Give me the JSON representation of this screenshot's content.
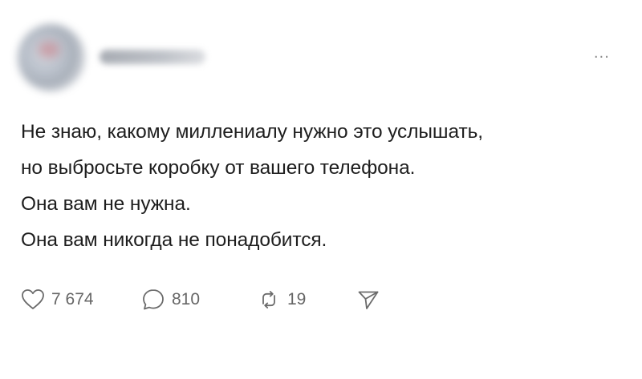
{
  "post": {
    "author_name": "",
    "more_label": "...",
    "lines": [
      "Не знаю, какому миллениалу нужно это услышать,",
      "но выбросьте коробку от вашего телефона.",
      "Она вам не нужна.",
      "Она вам никогда не понадобится."
    ],
    "actions": {
      "likes": "7 674",
      "comments": "810",
      "reposts": "19"
    }
  },
  "icons": {
    "like": "heart-icon",
    "comment": "comment-bubble-icon",
    "repost": "repost-icon",
    "share": "send-icon"
  },
  "colors": {
    "text": "#1e1e1e",
    "muted": "#666666",
    "background": "#ffffff"
  }
}
